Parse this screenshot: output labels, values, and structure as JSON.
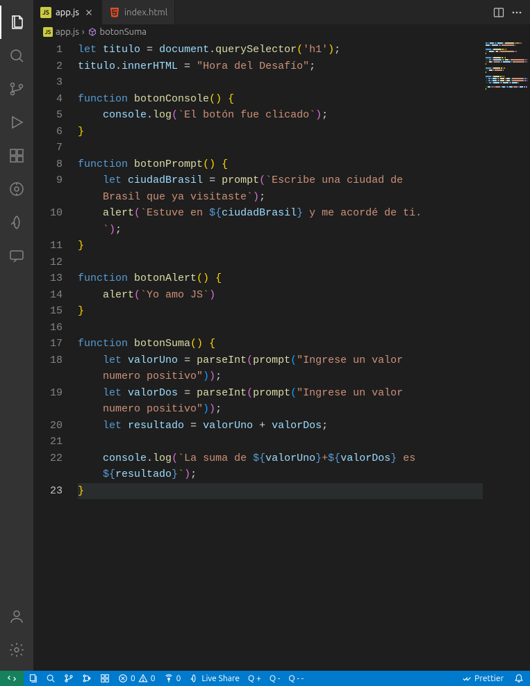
{
  "activity_bar": {
    "items": [
      "explorer",
      "search",
      "source-control",
      "run-debug",
      "extensions",
      "gitlens",
      "live-share",
      "chat"
    ],
    "bottom": [
      "accounts",
      "settings"
    ]
  },
  "tabs": [
    {
      "file_icon": "js",
      "label": "app.js",
      "active": true,
      "close_visible": true
    },
    {
      "file_icon": "html",
      "label": "index.html",
      "active": false,
      "close_visible": false
    }
  ],
  "breadcrumbs": {
    "file_icon": "js",
    "file": "app.js",
    "symbol_icon": "method",
    "symbol": "botonSuma"
  },
  "line_count": 23,
  "active_line": 23,
  "code_lines": [
    [
      {
        "c": "kw",
        "t": "let"
      },
      {
        "c": "punc",
        "t": " "
      },
      {
        "c": "var",
        "t": "titulo"
      },
      {
        "c": "punc",
        "t": " = "
      },
      {
        "c": "var",
        "t": "document"
      },
      {
        "c": "punc",
        "t": "."
      },
      {
        "c": "fndef",
        "t": "querySelector"
      },
      {
        "c": "bracket1",
        "t": "("
      },
      {
        "c": "str",
        "t": "'h1'"
      },
      {
        "c": "bracket1",
        "t": ")"
      },
      {
        "c": "punc",
        "t": ";"
      }
    ],
    [
      {
        "c": "var",
        "t": "titulo"
      },
      {
        "c": "punc",
        "t": "."
      },
      {
        "c": "var",
        "t": "innerHTML"
      },
      {
        "c": "punc",
        "t": " = "
      },
      {
        "c": "str",
        "t": "\"Hora del Desafío\""
      },
      {
        "c": "punc",
        "t": ";"
      }
    ],
    [],
    [
      {
        "c": "kw",
        "t": "function"
      },
      {
        "c": "punc",
        "t": " "
      },
      {
        "c": "fndef",
        "t": "botonConsole"
      },
      {
        "c": "bracket1",
        "t": "()"
      },
      {
        "c": "punc",
        "t": " "
      },
      {
        "c": "bracket1",
        "t": "{"
      }
    ],
    [
      {
        "c": "indent-guide",
        "t": "    "
      },
      {
        "c": "var",
        "t": "console"
      },
      {
        "c": "punc",
        "t": "."
      },
      {
        "c": "fndef",
        "t": "log"
      },
      {
        "c": "bracket2",
        "t": "("
      },
      {
        "c": "str",
        "t": "`El botón fue clicado`"
      },
      {
        "c": "bracket2",
        "t": ")"
      },
      {
        "c": "punc",
        "t": ";"
      }
    ],
    [
      {
        "c": "bracket1",
        "t": "}"
      }
    ],
    [],
    [
      {
        "c": "kw",
        "t": "function"
      },
      {
        "c": "punc",
        "t": " "
      },
      {
        "c": "fndef",
        "t": "botonPrompt"
      },
      {
        "c": "bracket1",
        "t": "()"
      },
      {
        "c": "punc",
        "t": " "
      },
      {
        "c": "bracket1",
        "t": "{"
      }
    ],
    [
      {
        "c": "indent-guide",
        "t": "    "
      },
      {
        "c": "kw",
        "t": "let"
      },
      {
        "c": "punc",
        "t": " "
      },
      {
        "c": "var",
        "t": "ciudadBrasil"
      },
      {
        "c": "punc",
        "t": " = "
      },
      {
        "c": "fndef",
        "t": "prompt"
      },
      {
        "c": "bracket2",
        "t": "("
      },
      {
        "c": "str",
        "t": "`Escribe una ciudad de \n    Brasil que ya visitaste`"
      },
      {
        "c": "bracket2",
        "t": ")"
      },
      {
        "c": "punc",
        "t": ";"
      }
    ],
    [
      {
        "c": "indent-guide",
        "t": "    "
      },
      {
        "c": "fndef",
        "t": "alert"
      },
      {
        "c": "bracket2",
        "t": "("
      },
      {
        "c": "str",
        "t": "`Estuve en "
      },
      {
        "c": "interp",
        "t": "${"
      },
      {
        "c": "var",
        "t": "ciudadBrasil"
      },
      {
        "c": "interp",
        "t": "}"
      },
      {
        "c": "str",
        "t": " y me acordé de ti.\n    `"
      },
      {
        "c": "bracket2",
        "t": ")"
      },
      {
        "c": "punc",
        "t": ";"
      }
    ],
    [
      {
        "c": "bracket1",
        "t": "}"
      }
    ],
    [],
    [
      {
        "c": "kw",
        "t": "function"
      },
      {
        "c": "punc",
        "t": " "
      },
      {
        "c": "fndef",
        "t": "botonAlert"
      },
      {
        "c": "bracket1",
        "t": "()"
      },
      {
        "c": "punc",
        "t": " "
      },
      {
        "c": "bracket1",
        "t": "{"
      }
    ],
    [
      {
        "c": "indent-guide",
        "t": "    "
      },
      {
        "c": "fndef",
        "t": "alert"
      },
      {
        "c": "bracket2",
        "t": "("
      },
      {
        "c": "str",
        "t": "`Yo amo JS`"
      },
      {
        "c": "bracket2",
        "t": ")"
      }
    ],
    [
      {
        "c": "bracket1",
        "t": "}"
      }
    ],
    [],
    [
      {
        "c": "kw",
        "t": "function"
      },
      {
        "c": "punc",
        "t": " "
      },
      {
        "c": "fndef",
        "t": "botonSuma"
      },
      {
        "c": "bracket1",
        "t": "()"
      },
      {
        "c": "punc",
        "t": " "
      },
      {
        "c": "bracket1",
        "t": "{"
      }
    ],
    [
      {
        "c": "indent-guide",
        "t": "    "
      },
      {
        "c": "kw",
        "t": "let"
      },
      {
        "c": "punc",
        "t": " "
      },
      {
        "c": "var",
        "t": "valorUno"
      },
      {
        "c": "punc",
        "t": " = "
      },
      {
        "c": "fndef",
        "t": "parseInt"
      },
      {
        "c": "bracket2",
        "t": "("
      },
      {
        "c": "fndef",
        "t": "prompt"
      },
      {
        "c": "bracket3",
        "t": "("
      },
      {
        "c": "str",
        "t": "\"Ingrese un valor \n    numero positivo\""
      },
      {
        "c": "bracket3",
        "t": ")"
      },
      {
        "c": "bracket2",
        "t": ")"
      },
      {
        "c": "punc",
        "t": ";"
      }
    ],
    [
      {
        "c": "indent-guide",
        "t": "    "
      },
      {
        "c": "kw",
        "t": "let"
      },
      {
        "c": "punc",
        "t": " "
      },
      {
        "c": "var",
        "t": "valorDos"
      },
      {
        "c": "punc",
        "t": " = "
      },
      {
        "c": "fndef",
        "t": "parseInt"
      },
      {
        "c": "bracket2",
        "t": "("
      },
      {
        "c": "fndef",
        "t": "prompt"
      },
      {
        "c": "bracket3",
        "t": "("
      },
      {
        "c": "str",
        "t": "\"Ingrese un valor \n    numero positivo\""
      },
      {
        "c": "bracket3",
        "t": ")"
      },
      {
        "c": "bracket2",
        "t": ")"
      },
      {
        "c": "punc",
        "t": ";"
      }
    ],
    [
      {
        "c": "indent-guide",
        "t": "    "
      },
      {
        "c": "kw",
        "t": "let"
      },
      {
        "c": "punc",
        "t": " "
      },
      {
        "c": "var",
        "t": "resultado"
      },
      {
        "c": "punc",
        "t": " = "
      },
      {
        "c": "var",
        "t": "valorUno"
      },
      {
        "c": "punc",
        "t": " + "
      },
      {
        "c": "var",
        "t": "valorDos"
      },
      {
        "c": "punc",
        "t": ";"
      }
    ],
    [],
    [
      {
        "c": "indent-guide",
        "t": "    "
      },
      {
        "c": "var",
        "t": "console"
      },
      {
        "c": "punc",
        "t": "."
      },
      {
        "c": "fndef",
        "t": "log"
      },
      {
        "c": "bracket2",
        "t": "("
      },
      {
        "c": "str",
        "t": "`La suma de "
      },
      {
        "c": "interp",
        "t": "${"
      },
      {
        "c": "var",
        "t": "valorUno"
      },
      {
        "c": "interp",
        "t": "}"
      },
      {
        "c": "str",
        "t": "+"
      },
      {
        "c": "interp",
        "t": "${"
      },
      {
        "c": "var",
        "t": "valorDos"
      },
      {
        "c": "interp",
        "t": "}"
      },
      {
        "c": "str",
        "t": " es \n    "
      },
      {
        "c": "interp",
        "t": "${"
      },
      {
        "c": "var",
        "t": "resultado"
      },
      {
        "c": "interp",
        "t": "}"
      },
      {
        "c": "str",
        "t": "`"
      },
      {
        "c": "bracket2",
        "t": ")"
      },
      {
        "c": "punc",
        "t": ";"
      }
    ],
    [
      {
        "c": "bracket1",
        "t": "}"
      }
    ]
  ],
  "status": {
    "errors": "0",
    "warnings": "0",
    "ports": "0",
    "live_share": "Live Share",
    "q_plus": "Q +",
    "q_minus": "Q -",
    "q_dash": "Q - -",
    "prettier": "Prettier"
  }
}
